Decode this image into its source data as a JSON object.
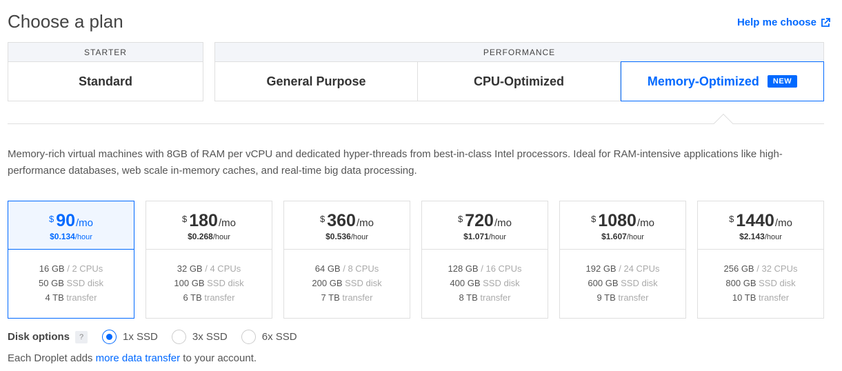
{
  "page_title": "Choose a plan",
  "help_link": "Help me choose",
  "groups": {
    "starter": {
      "label": "STARTER",
      "tabs": [
        "Standard"
      ]
    },
    "performance": {
      "label": "PERFORMANCE",
      "tabs": [
        "General Purpose",
        "CPU-Optimized",
        "Memory-Optimized"
      ]
    }
  },
  "active_tab": "Memory-Optimized",
  "new_badge": "NEW",
  "description": "Memory-rich virtual machines with 8GB of RAM per vCPU and dedicated hyper-threads from best-in-class Intel processors. Ideal for RAM-intensive applications like high-performance databases, web scale in-memory caches, and real-time big data processing.",
  "currency": "$",
  "per_month": "/mo",
  "per_hour": "/hour",
  "plans": [
    {
      "monthly": "90",
      "hourly": "$0.134",
      "mem": "16 GB",
      "cpu": "/ 2 CPUs",
      "disk": "50 GB",
      "disk_unit": "SSD disk",
      "transfer": "4 TB",
      "transfer_unit": "transfer"
    },
    {
      "monthly": "180",
      "hourly": "$0.268",
      "mem": "32 GB",
      "cpu": "/ 4 CPUs",
      "disk": "100 GB",
      "disk_unit": "SSD disk",
      "transfer": "6 TB",
      "transfer_unit": "transfer"
    },
    {
      "monthly": "360",
      "hourly": "$0.536",
      "mem": "64 GB",
      "cpu": "/ 8 CPUs",
      "disk": "200 GB",
      "disk_unit": "SSD disk",
      "transfer": "7 TB",
      "transfer_unit": "transfer"
    },
    {
      "monthly": "720",
      "hourly": "$1.071",
      "mem": "128 GB",
      "cpu": "/ 16 CPUs",
      "disk": "400 GB",
      "disk_unit": "SSD disk",
      "transfer": "8 TB",
      "transfer_unit": "transfer"
    },
    {
      "monthly": "1080",
      "hourly": "$1.607",
      "mem": "192 GB",
      "cpu": "/ 24 CPUs",
      "disk": "600 GB",
      "disk_unit": "SSD disk",
      "transfer": "9 TB",
      "transfer_unit": "transfer"
    },
    {
      "monthly": "1440",
      "hourly": "$2.143",
      "mem": "256 GB",
      "cpu": "/ 32 CPUs",
      "disk": "800 GB",
      "disk_unit": "SSD disk",
      "transfer": "10 TB",
      "transfer_unit": "transfer"
    }
  ],
  "selected_plan_index": 0,
  "disk_options": {
    "label": "Disk options",
    "help": "?",
    "options": [
      "1x SSD",
      "3x SSD",
      "6x SSD"
    ],
    "selected": "1x SSD"
  },
  "footer": {
    "before": "Each Droplet adds ",
    "link": "more data transfer",
    "after": " to your account."
  },
  "colors": {
    "accent": "#0069ff",
    "border": "#dfdfdf",
    "header_bg": "#f3f5f9"
  },
  "icons": {
    "help_link": "external-link-icon"
  }
}
